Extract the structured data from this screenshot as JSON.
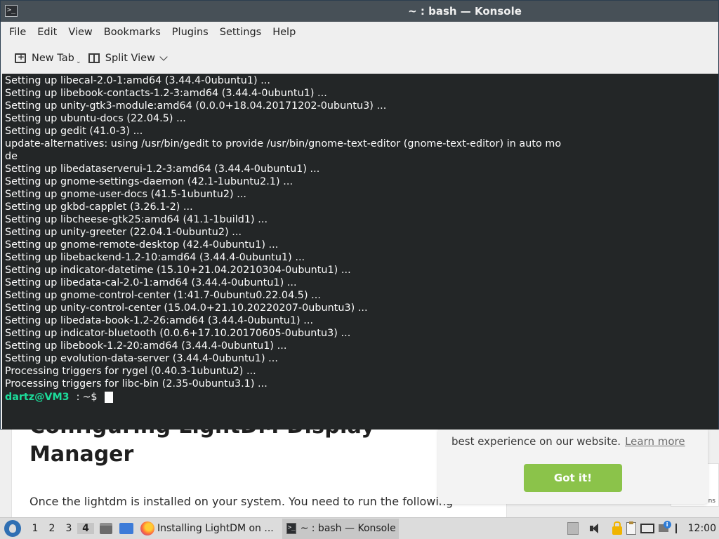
{
  "window": {
    "title": "~ : bash — Konsole"
  },
  "menubar": [
    "File",
    "Edit",
    "View",
    "Bookmarks",
    "Plugins",
    "Settings",
    "Help"
  ],
  "toolbar": {
    "new_tab": "New Tab",
    "split_view": "Split View"
  },
  "terminal": {
    "lines": [
      "Setting up libecal-2.0-1:amd64 (3.44.4-0ubuntu1) ...",
      "Setting up libebook-contacts-1.2-3:amd64 (3.44.4-0ubuntu1) ...",
      "Setting up unity-gtk3-module:amd64 (0.0.0+18.04.20171202-0ubuntu3) ...",
      "Setting up ubuntu-docs (22.04.5) ...",
      "Setting up gedit (41.0-3) ...",
      "update-alternatives: using /usr/bin/gedit to provide /usr/bin/gnome-text-editor (gnome-text-editor) in auto mo",
      "de",
      "Setting up libedataserverui-1.2-3:amd64 (3.44.4-0ubuntu1) ...",
      "Setting up gnome-settings-daemon (42.1-1ubuntu2.1) ...",
      "Setting up gnome-user-docs (41.5-1ubuntu2) ...",
      "Setting up gkbd-capplet (3.26.1-2) ...",
      "Setting up libcheese-gtk25:amd64 (41.1-1build1) ...",
      "Setting up unity-greeter (22.04.1-0ubuntu2) ...",
      "Setting up gnome-remote-desktop (42.4-0ubuntu1) ...",
      "Setting up libebackend-1.2-10:amd64 (3.44.4-0ubuntu1) ...",
      "Setting up indicator-datetime (15.10+21.04.20210304-0ubuntu1) ...",
      "Setting up libedata-cal-2.0-1:amd64 (3.44.4-0ubuntu1) ...",
      "Setting up gnome-control-center (1:41.7-0ubuntu0.22.04.5) ...",
      "Setting up unity-control-center (15.04.0+21.10.20220207-0ubuntu3) ...",
      "Setting up libedata-book-1.2-26:amd64 (3.44.4-0ubuntu1) ...",
      "Setting up indicator-bluetooth (0.0.6+17.10.20170605-0ubuntu3) ...",
      "Setting up libebook-1.2-20:amd64 (3.44.4-0ubuntu1) ...",
      "Setting up evolution-data-server (3.44.4-0ubuntu1) ...",
      "Processing triggers for rygel (0.40.3-1ubuntu2) ...",
      "Processing triggers for libc-bin (2.35-0ubuntu3.1) ..."
    ],
    "prompt": {
      "user_host": "dartz@VM3",
      "separator": ":",
      "cwd": "~$"
    }
  },
  "webpage": {
    "heading": "Manager",
    "paragraph": "Once the lightdm is installed on your system. You need to run the following",
    "sidebar_fragment": "ns"
  },
  "cookie_popup": {
    "message": "best experience on our website.",
    "link": "Learn more",
    "button": "Got it!",
    "button_color": "#8bc34a"
  },
  "taskbar": {
    "desktops": [
      "1",
      "2",
      "3",
      "4"
    ],
    "active_desktop": "4",
    "tasks": [
      {
        "icon": "firefox-icon",
        "label": "Installing LightDM on ..."
      },
      {
        "icon": "terminal-icon",
        "label": "~ : bash — Konsole"
      }
    ],
    "clock": "12:00"
  },
  "colors": {
    "terminal_bg": "#232627",
    "terminal_fg": "#fcfcfc",
    "prompt_user": "#1cdc9a",
    "titlebar_bg": "#475057"
  }
}
